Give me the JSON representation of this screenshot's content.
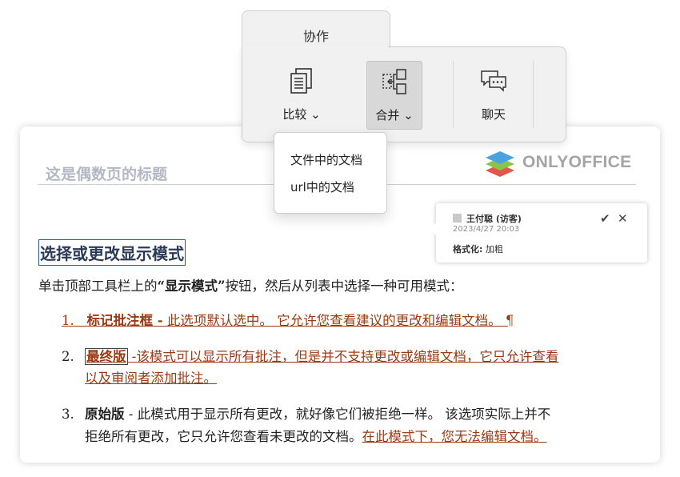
{
  "toolbar": {
    "tab_label": "协作",
    "buttons": [
      {
        "label": "比较 ⌄",
        "icon": "compare-icon"
      },
      {
        "label": "合并 ⌄",
        "icon": "merge-icon"
      },
      {
        "label": "聊天",
        "icon": "chat-icon"
      }
    ]
  },
  "dropdown": {
    "items": [
      "文件中的文档",
      "url中的文档"
    ]
  },
  "document": {
    "logo_text": "ONLYOFFICE",
    "header_text": "这是偶数页的标题",
    "section_title": "选择或更改显示模式",
    "intro_prefix": "单击顶部工具栏上的",
    "intro_bold": "“显示模式”",
    "intro_suffix": "按钮，然后从列表中选择一种可用模式：",
    "list": [
      {
        "num": "1.",
        "bold": "标记批注框 -",
        "text": " 此选项默认选中。 它允许您查看建议的更改和编辑文档。 ¶"
      },
      {
        "num": "2.",
        "bold": "最终版",
        "text_line1": " -该模式可以显示所有批注，但是并不支持更改或编辑文档，它只允许查看",
        "text_line2": "以及审阅者添加批注。"
      },
      {
        "num": "3.",
        "bold": "原始版",
        "text_line1": " - 此模式用于显示所有更改，就好像它们被拒绝一样。 该选项实际上并不",
        "text_line2_plain": "拒绝所有更改，它只允许您查看未更改的文档。",
        "text_line2_tracked": "在此模式下，您无法编辑文档。"
      }
    ]
  },
  "comment": {
    "author": "王付聪 (访客)",
    "date": "2023/4/27 20:03",
    "body_label": "格式化:",
    "body_value": " 加粗",
    "accept_icon": "✔",
    "reject_icon": "✕"
  },
  "colors": {
    "tracked_change": "#9b3a12",
    "toolbar_bg": "#f1f1f1",
    "logo_gray": "#a4a4a4"
  }
}
